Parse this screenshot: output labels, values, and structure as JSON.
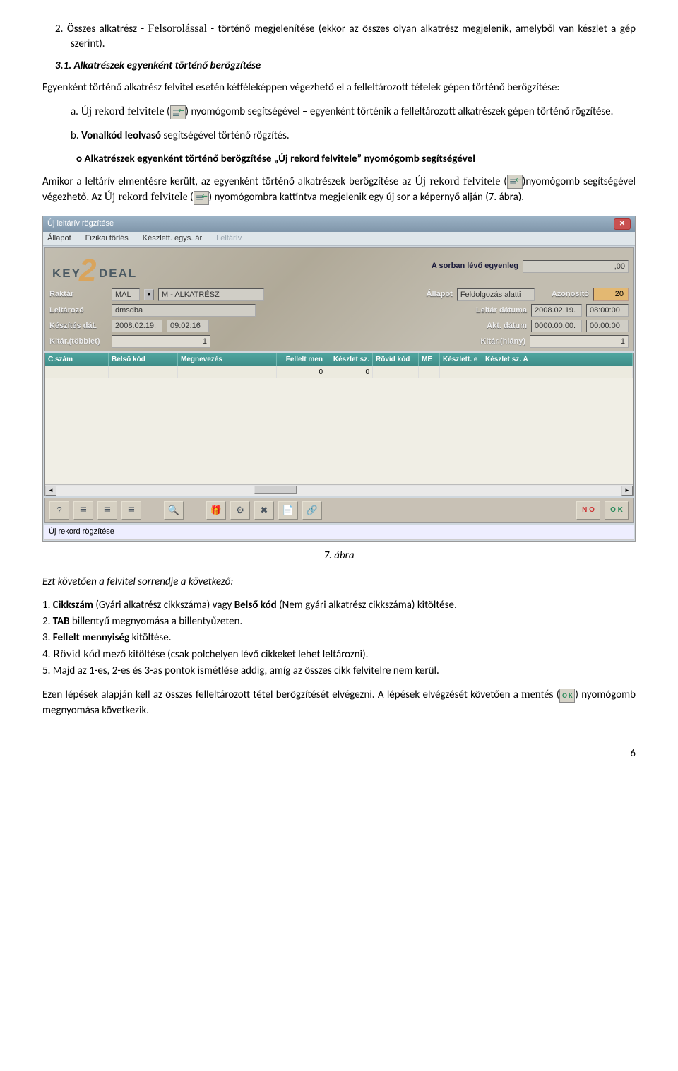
{
  "doc": {
    "item2_pre": "Összes alkatrész - ",
    "item2_bold": "Felsorolással",
    "item2_post": " - történő megjelenítése (ekkor az összes olyan alkatrész megjelenik, amelyből van készlet a gép szerint).",
    "h31": "3.1.  Alkatrészek egyenként történő berögzítése",
    "intro": "Egyenként történő alkatrész felvitel esetén kétféleképpen végezhető el a felleltározott tételek gépen történő berögzítése:",
    "a_pre": "a. ",
    "a_link": "Új rekord felvitele",
    "a_post1": " (",
    "a_post2": ") nyomógomb segítségével – egyenként történik a felleltározott alkatrészek gépen történő rögzítése.",
    "b_pre": "b. ",
    "b_bold": "Vonalkód leolvasó",
    "b_post": " segítségével történő rögzítés.",
    "circle": "Alkatrészek egyenként történő berögzítése „Új rekord felvitele” nyomógomb segítségével",
    "p1_pre": "Amikor a leltárív elmentésre került, az egyenként történő alkatrészek berögzítése az ",
    "p1_serif1": "Új rekord felvitele",
    "p1_mid1": " (",
    "p1_mid2": ")nyomógomb segítségével végezhető. Az ",
    "p1_serif2": "Új rekord felvitele",
    "p1_mid3": " (",
    "p1_end": ") nyomógombra kattintva megjelenik egy új sor a képernyő alján (7. ábra).",
    "caption": "7. ábra",
    "p2": "Ezt követően a felvitel sorrendje a következő:",
    "step1_pre": "1. ",
    "step1_b1": "Cikkszám",
    "step1_mid": " (Gyári alkatrész cikkszáma) vagy ",
    "step1_b2": "Belső kód",
    "step1_end": " (Nem gyári alkatrész cikkszáma) kitöltése.",
    "step2_pre": "2. ",
    "step2_b": "TAB",
    "step2_end": " billentyű megnyomása a billentyűzeten.",
    "step3_pre": "3. ",
    "step3_b": "Fellelt mennyiség",
    "step3_end": " kitöltése.",
    "step4_pre": "4. ",
    "step4_serif": "Rövid kód",
    "step4_end": " mező kitöltése (csak polchelyen lévő cikkeket lehet leltározni).",
    "step5": "5. Majd az 1-es, 2-es és 3-as pontok ismétlése addig, amíg az összes cikk felvitelre nem kerül.",
    "p3_pre": "Ezen lépések alapján kell az összes felleltározott tétel berögzítését elvégezni. A lépések elvégzését követően a ",
    "p3_serif": "mentés",
    "p3_mid": " (",
    "p3_end": ") nyomógomb megnyomása következik.",
    "pagenum": "6"
  },
  "app": {
    "title": "Új leltárív rögzítése",
    "menu": {
      "m1": "Állapot",
      "m2": "Fizikai törlés",
      "m3": "Készlett. egys. ár",
      "m4": "Leltárív"
    },
    "logo_key": "KEY",
    "logo_deal": "DEAL",
    "logo_two": "2",
    "balance_lbl": "A sorban lévő egyenleg",
    "balance_val": ",00",
    "f_raktar": "Raktár",
    "f_raktar_code": "MAL",
    "f_raktar_name": "M - ALKATRÉSZ",
    "f_allapot": "Állapot",
    "f_allapot_val": "Feldolgozás alatti",
    "f_azonosito": "Azonosító",
    "f_azonosito_val": "20",
    "f_leltarozo": "Leltározó",
    "f_leltarozo_val": "dmsdba",
    "f_leltdat": "Leltár dátuma",
    "f_leltdat_d": "2008.02.19.",
    "f_leltdat_t": "08:00:00",
    "f_keszdat": "Készítés dát.",
    "f_keszdat_d": "2008.02.19.",
    "f_keszdat_t": "09:02:16",
    "f_aktdat": "Akt. dátum",
    "f_aktdat_d": "0000.00.00.",
    "f_aktdat_t": "00:00:00",
    "f_kitartobb": "Kitár.(többlet)",
    "f_kitartobb_v": "1",
    "f_kitarhiany": "Kitár.(hiány)",
    "f_kitarhiany_v": "1",
    "cols": {
      "c1": "C.szám",
      "c2": "Belső kód",
      "c3": "Megnevezés",
      "c4": "Fellelt men",
      "c5": "Készlet sz.",
      "c6": "Rövid kód",
      "c7": "ME",
      "c8": "Készlett. e",
      "c9": "Készlet sz. A"
    },
    "row1": {
      "c4": "0",
      "c5": "0"
    },
    "toolbar": {
      "help": "?",
      "list1": "≣",
      "list2": "≣",
      "rec": "≣",
      "find": "🔍",
      "gift": "🎁",
      "gear": "⚙",
      "del": "✖",
      "copy": "📄",
      "link": "🔗",
      "no": "N O",
      "ok": "O K"
    },
    "status": "Új rekord rögzítése"
  }
}
